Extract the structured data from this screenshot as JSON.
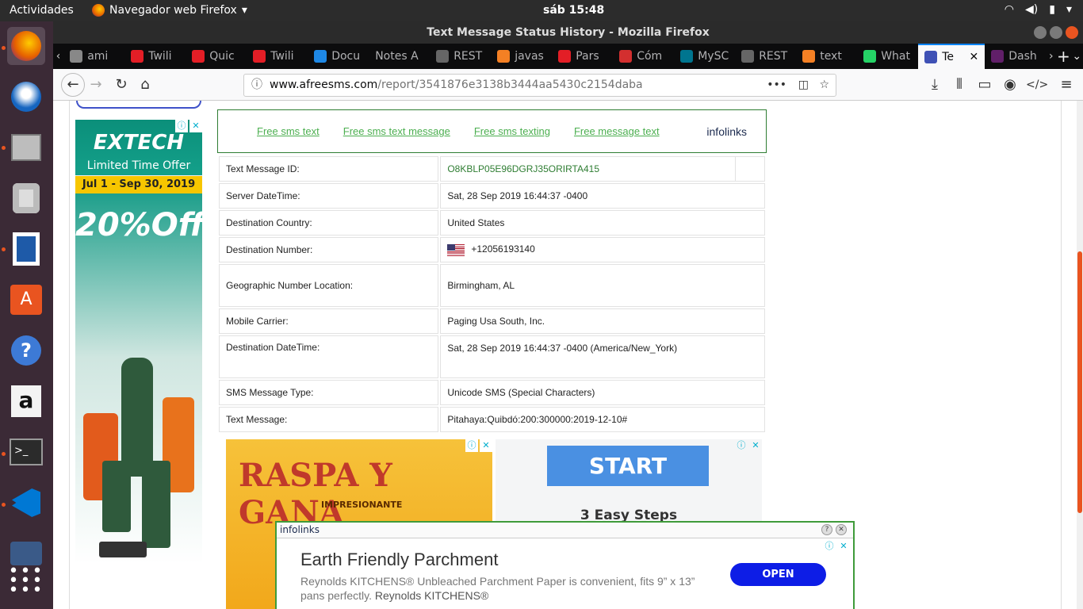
{
  "topbar": {
    "activities": "Actividades",
    "app_name": "Navegador web Firefox",
    "clock": "sáb 15:48"
  },
  "window": {
    "title": "Text Message Status History - Mozilla Firefox"
  },
  "tabs": [
    {
      "label": "ami",
      "icon": "generic-tab-icon",
      "color": "#888888"
    },
    {
      "label": "Twili",
      "icon": "twilio-icon",
      "color": "#e31e26"
    },
    {
      "label": "Quic",
      "icon": "twilio-icon",
      "color": "#e31e26"
    },
    {
      "label": "Twili",
      "icon": "twilio-icon",
      "color": "#e31e26"
    },
    {
      "label": "Docu",
      "icon": "vscode-icon",
      "color": "#1e88e5"
    },
    {
      "label": "Notes A",
      "icon": "none",
      "color": "#0c0c0d"
    },
    {
      "label": "REST",
      "icon": "code-icon",
      "color": "#666666"
    },
    {
      "label": "javas",
      "icon": "stackoverflow-icon",
      "color": "#f48024"
    },
    {
      "label": "Pars",
      "icon": "twilio-icon",
      "color": "#e31e26"
    },
    {
      "label": "Cóm",
      "icon": "question-icon",
      "color": "#d32f2f"
    },
    {
      "label": "MySC",
      "icon": "mysql-icon",
      "color": "#00758f"
    },
    {
      "label": "REST",
      "icon": "code-icon",
      "color": "#666666"
    },
    {
      "label": "text",
      "icon": "stackoverflow-icon",
      "color": "#f48024"
    },
    {
      "label": "What",
      "icon": "whatsapp-icon",
      "color": "#25d366"
    },
    {
      "label": "Te",
      "icon": "phone-icon",
      "color": "#3f51b5",
      "active": true
    },
    {
      "label": "Dash",
      "icon": "slack-icon",
      "color": "#611f69"
    }
  ],
  "urlbar": {
    "host": "www.afreesms.com",
    "path": "/report/3541876e3138b3444aa5430c2154daba"
  },
  "left_ad": {
    "brand": "EXTECH",
    "offer": "Limited Time Offer",
    "dates": "Jul 1 - Sep 30, 2019",
    "discount": "20%Off"
  },
  "links": {
    "items": [
      "Free sms text",
      "Free sms text message",
      "Free sms texting",
      "Free message text"
    ],
    "provider": "infolinks"
  },
  "report": {
    "rows": [
      {
        "key": "Text Message ID:",
        "value": "O8KBLP05E96DGRJ35ORIRTA415"
      },
      {
        "key": "Server DateTime:",
        "value": "Sat, 28 Sep 2019 16:44:37 -0400"
      },
      {
        "key": "Destination Country:",
        "value": "United States"
      },
      {
        "key": "Destination Number:",
        "value": "+12056193140"
      },
      {
        "key": "Geographic Number Location:",
        "value": "Birmingham, AL"
      },
      {
        "key": "Mobile Carrier:",
        "value": "Paging Usa South, Inc."
      },
      {
        "key": "Destination DateTime:",
        "value": "Sat, 28 Sep 2019 16:44:37 -0400 (America/New_York)"
      },
      {
        "key": "SMS Message Type:",
        "value": "Unicode SMS (Special Characters)"
      },
      {
        "key": "Text Message:",
        "value": "Pitahaya:Quibdó:200:300000:2019-12-10#"
      }
    ]
  },
  "ad_raspa": {
    "title": "RASPA Y GANA",
    "subtitle": "IMPRESIONANTE"
  },
  "ad_start": {
    "button": "START",
    "steps": "3 Easy Steps"
  },
  "popup": {
    "logo": "infolinks",
    "title": "Earth Friendly Parchment",
    "desc": "Reynolds KITCHENS® Unbleached Parchment Paper is convenient, fits 9” x 13” pans perfectly.",
    "brand": "Reynolds KITCHENS®",
    "cta": "OPEN"
  }
}
